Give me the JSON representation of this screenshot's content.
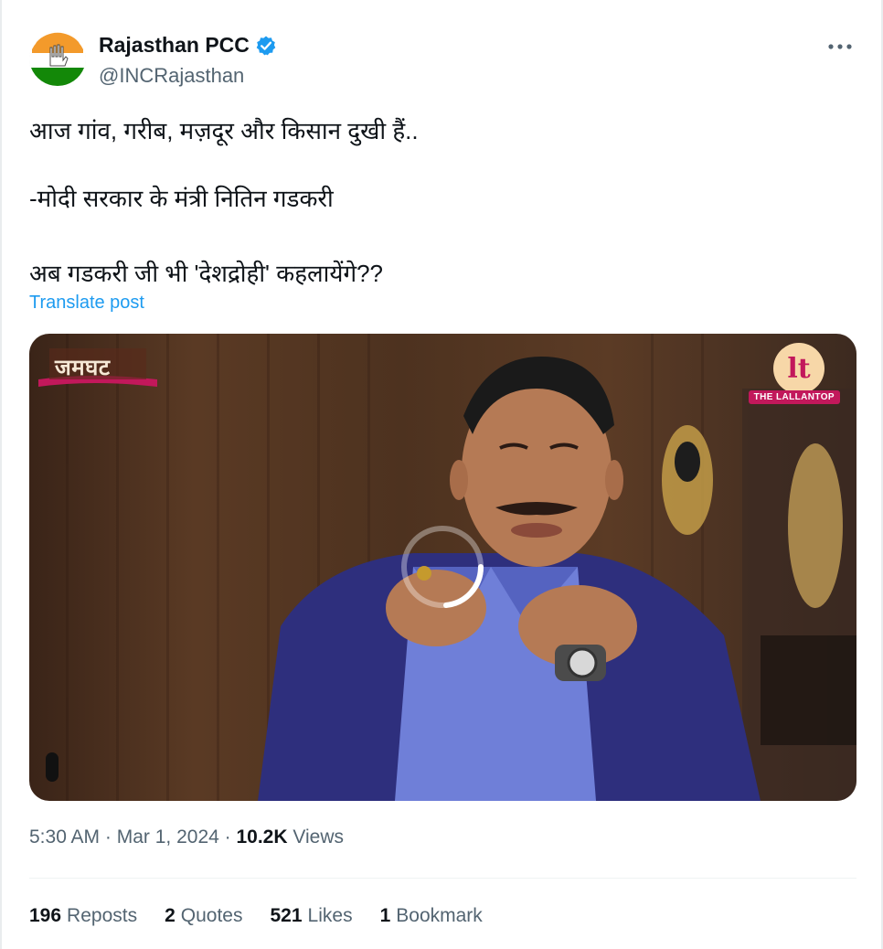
{
  "header": {
    "display_name": "Rajasthan PCC",
    "handle": "@INCRajasthan",
    "more_icon": "more-horizontal-icon"
  },
  "tweet": {
    "line1": "आज गांव, गरीब, मज़दूर और किसान दुखी हैं..",
    "line2": "-मोदी सरकार के मंत्री नितिन गडकरी",
    "line3": "अब गडकरी जी भी 'देशद्रोही' कहलायेंगे??",
    "translate_label": "Translate post"
  },
  "media": {
    "show_logo_text": "जमघट",
    "channel_badge": "THE LALLANTOP"
  },
  "meta": {
    "time": "5:30 AM",
    "sep1": " · ",
    "date": "Mar 1, 2024",
    "sep2": " · ",
    "views_count": "10.2K",
    "views_label": " Views"
  },
  "stats": {
    "reposts_count": "196",
    "reposts_label": "Reposts",
    "quotes_count": "2",
    "quotes_label": "Quotes",
    "likes_count": "521",
    "likes_label": "Likes",
    "bookmarks_count": "1",
    "bookmarks_label": "Bookmark"
  },
  "colors": {
    "link": "#1d9bf0",
    "secondary_text": "#536471",
    "verified": "#1d9bf0"
  }
}
